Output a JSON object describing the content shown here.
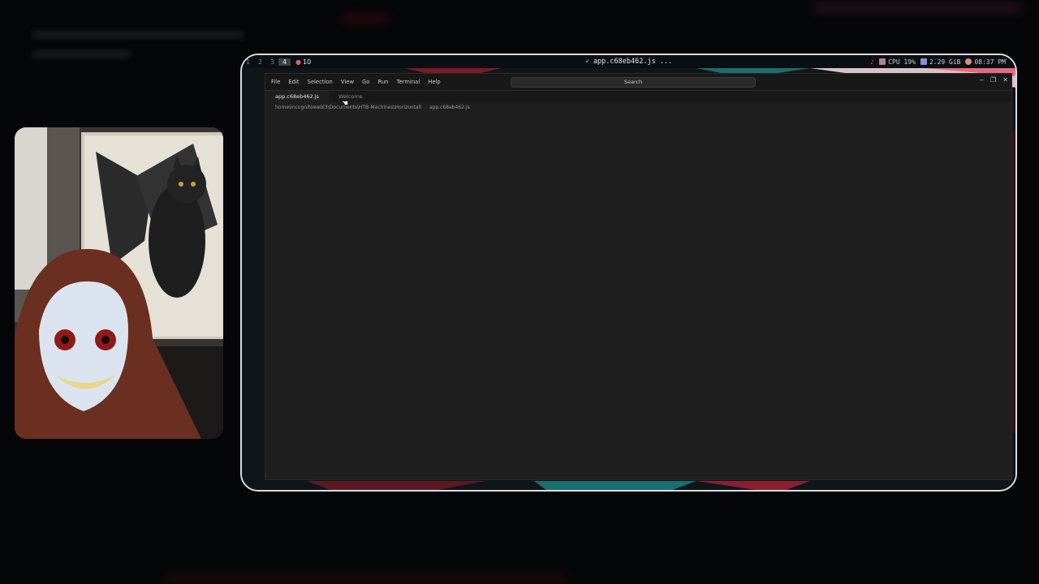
{
  "desktop": {
    "workspaces": [
      "1",
      "2",
      "3",
      "4"
    ],
    "active_workspace": "4",
    "notification_count": "10",
    "window_title": "app.c68eb462.js ...",
    "tray": {
      "cpu": "CPU 19%",
      "memory": "2.29 GiB",
      "clock": "08:37 PM"
    }
  },
  "vscode": {
    "menu": [
      "File",
      "Edit",
      "Selection",
      "View",
      "Go",
      "Run",
      "Terminal",
      "Help"
    ],
    "search_label": "Search",
    "tabs": [
      {
        "label": "app.c68eb462.js",
        "active": true
      },
      {
        "label": "Welcome",
        "active": false
      }
    ],
    "breadcrumb": {
      "path": "home\\incognitowebl3\\Documents\\HTB-Machines\\Horizontall",
      "file": "app.c68eb462.js"
    }
  },
  "colors": {
    "accent_blue": "#3b82f6",
    "frame_border": "#d8dde2",
    "alert_red": "#e05a6b"
  }
}
